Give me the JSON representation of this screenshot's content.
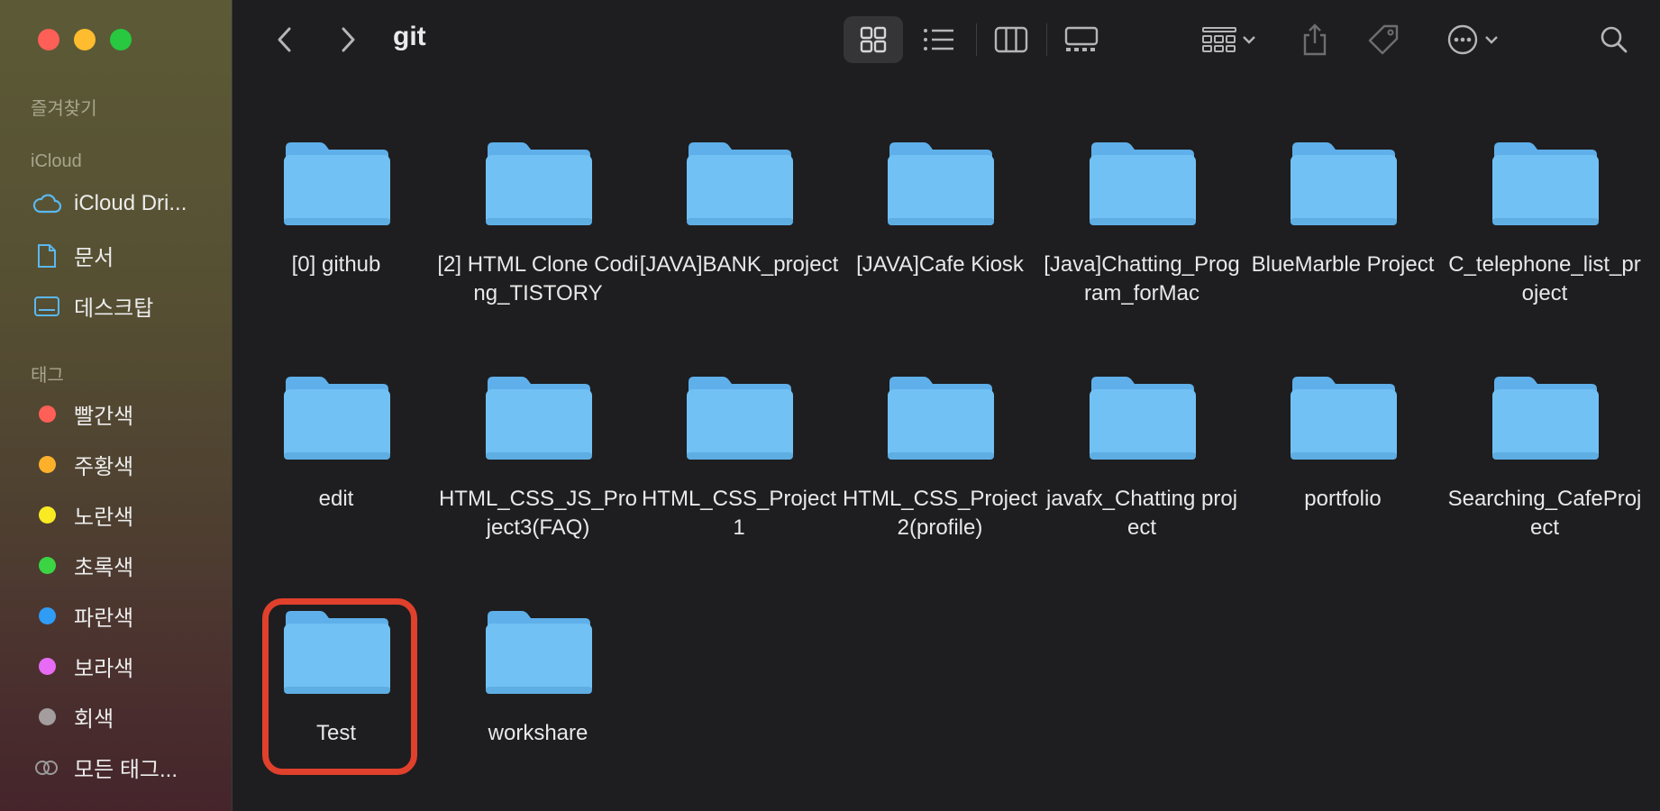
{
  "window": {
    "title": "git"
  },
  "sidebar": {
    "favorites_label": "즐겨찾기",
    "icloud_label": "iCloud",
    "icloud_items": [
      {
        "label": "iCloud Dri...",
        "icon": "cloud-icon"
      },
      {
        "label": "문서",
        "icon": "document-icon"
      },
      {
        "label": "데스크탑",
        "icon": "desktop-icon"
      }
    ],
    "tags_label": "태그",
    "tags": [
      {
        "label": "빨간색",
        "color": "#fe5f57"
      },
      {
        "label": "주황색",
        "color": "#fdb12b"
      },
      {
        "label": "노란색",
        "color": "#f8ea23"
      },
      {
        "label": "초록색",
        "color": "#3bd443"
      },
      {
        "label": "파란색",
        "color": "#2f9cf5"
      },
      {
        "label": "보라색",
        "color": "#e76bf5"
      },
      {
        "label": "회색",
        "color": "#a39d9e"
      }
    ],
    "all_tags_label": "모든 태그..."
  },
  "toolbar": {
    "back": "back-chevron-icon",
    "forward": "forward-chevron-icon",
    "views": [
      "icon-view-icon",
      "list-view-icon",
      "column-view-icon",
      "gallery-view-icon"
    ],
    "group": "group-icon",
    "share": "share-icon",
    "tag": "tag-icon",
    "more": "more-icon",
    "search": "search-icon"
  },
  "files": [
    {
      "name": "[0] github"
    },
    {
      "name": "[2] HTML Clone Coding_TISTORY"
    },
    {
      "name": "[JAVA]BANK_project"
    },
    {
      "name": "[JAVA]Cafe Kiosk"
    },
    {
      "name": "[Java]Chatting_Program_forMac"
    },
    {
      "name": "BlueMarble Project"
    },
    {
      "name": "C_telephone_list_project"
    },
    {
      "name": "edit"
    },
    {
      "name": "HTML_CSS_JS_Project3(FAQ)"
    },
    {
      "name": "HTML_CSS_Project1"
    },
    {
      "name": "HTML_CSS_Project2(profile)"
    },
    {
      "name": "javafx_Chatting project"
    },
    {
      "name": "portfolio"
    },
    {
      "name": "Searching_CafeProject"
    },
    {
      "name": "Test"
    },
    {
      "name": "workshare"
    }
  ],
  "selected_file": "Test",
  "colors": {
    "folder": "#71c1f5",
    "folder_tab": "#5fb0ea",
    "highlight": "#e0402c"
  }
}
